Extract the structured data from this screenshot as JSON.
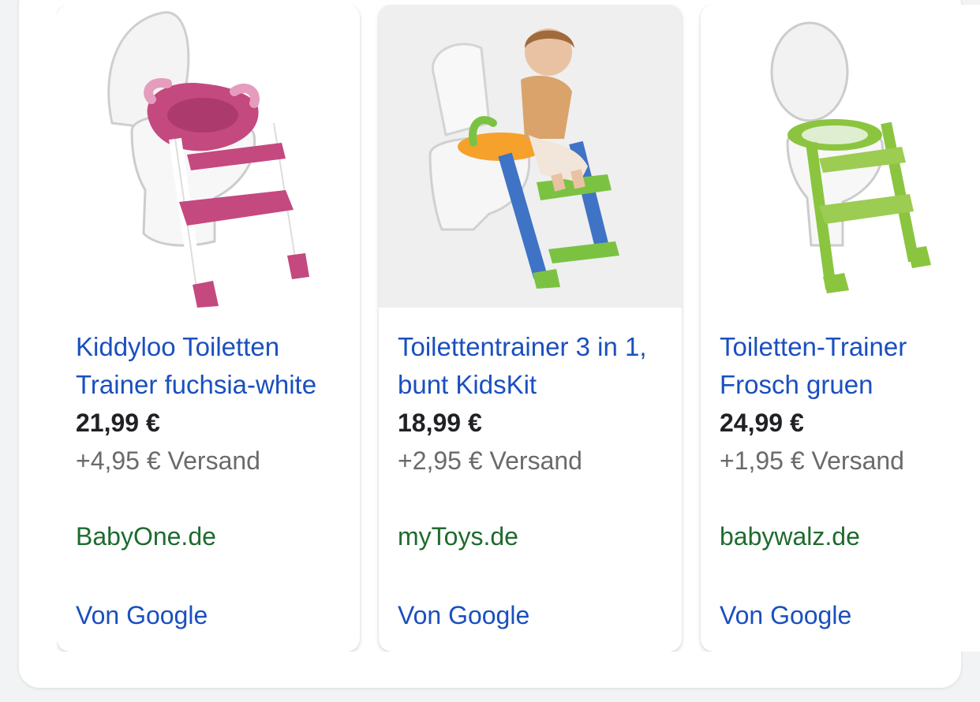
{
  "products": [
    {
      "title": "Kiddyloo Toiletten Trainer fuchsia-white",
      "price": "21,99 €",
      "shipping": "+4,95 € Versand",
      "store": "BabyOne.de",
      "source": "Von Google",
      "accent_color": "#c4497f"
    },
    {
      "title": "Toilettentrainer 3 in 1, bunt KidsKit",
      "price": "18,99 €",
      "shipping": "+2,95 € Versand",
      "store": "myToys.de",
      "source": "Von Google",
      "accent_color": "#3f73c6"
    },
    {
      "title": "Toiletten-Trainer Frosch gruen",
      "price": "24,99 €",
      "shipping": "+1,95 € Versand",
      "store": "babywalz.de",
      "source": "Von Google",
      "accent_color": "#8bc53f"
    }
  ],
  "colors": {
    "link": "#1a4fbf",
    "store": "#1e6b2e",
    "price": "#202124",
    "shipping": "#6a6a6a"
  }
}
